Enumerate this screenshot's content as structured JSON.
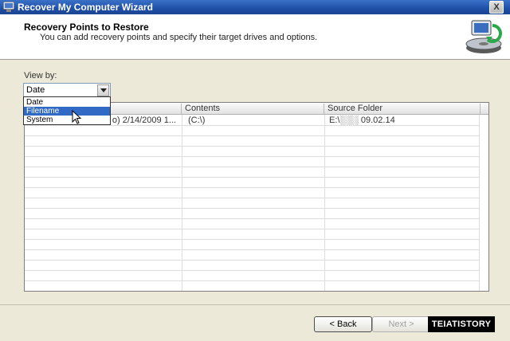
{
  "window": {
    "title": "Recover My Computer Wizard",
    "close_label": "X"
  },
  "header": {
    "title": "Recovery Points to Restore",
    "subtitle": "You can add recovery points and specify their target drives and options."
  },
  "view_by": {
    "label": "View by:",
    "selected": "Date",
    "options": [
      "Date",
      "Filename",
      "System"
    ],
    "highlighted": "Filename"
  },
  "table": {
    "columns": [
      "",
      "Contents",
      "Source Folder"
    ],
    "rows": [
      {
        "name": "o) 2/14/2009 1...",
        "contents": "(C:\\)",
        "source_folder": "E:\\░░░ 09.02.14"
      }
    ]
  },
  "footer": {
    "back_label": "< Back",
    "next_label": "Next >"
  },
  "watermark": "TEIATISTORY",
  "colors": {
    "titlebar": "#1f4fa6",
    "selection": "#316ac5",
    "background": "#ece9d8"
  }
}
